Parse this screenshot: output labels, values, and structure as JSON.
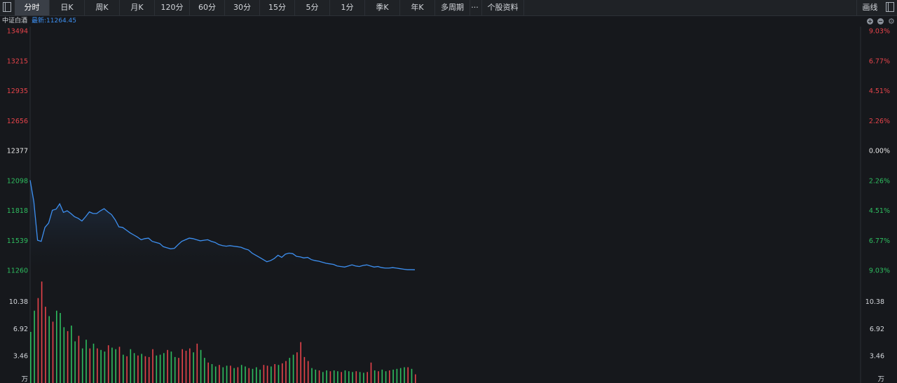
{
  "toolbar": {
    "tabs": [
      {
        "label": "分时",
        "active": true
      },
      {
        "label": "日K"
      },
      {
        "label": "周K"
      },
      {
        "label": "月K"
      },
      {
        "label": "120分"
      },
      {
        "label": "60分"
      },
      {
        "label": "30分"
      },
      {
        "label": "15分"
      },
      {
        "label": "5分"
      },
      {
        "label": "1分"
      },
      {
        "label": "季K"
      },
      {
        "label": "年K"
      },
      {
        "label": "多周期"
      }
    ],
    "more_label": "···",
    "stock_info_label": "个股资料",
    "draw_label": "画线"
  },
  "header": {
    "name": "中证白酒",
    "latest_label": "最新:11264.45"
  },
  "colors": {
    "up": "#e6434a",
    "down": "#2ebd5f",
    "neutral": "#e8e8e8",
    "line": "#3d8ff0",
    "background": "#16181c"
  },
  "chart_data": {
    "type": "line",
    "price_axis_labels": [
      "13494",
      "13215",
      "12935",
      "12656",
      "12377",
      "12098",
      "11818",
      "11539",
      "11260"
    ],
    "percent_axis_labels": [
      "9.03%",
      "6.77%",
      "4.51%",
      "2.26%",
      "0.00%",
      "2.26%",
      "4.51%",
      "6.77%",
      "9.03%"
    ],
    "ylim": [
      11260,
      13494
    ],
    "prev_close": 12377,
    "price": [
      12100,
      11900,
      11540,
      11530,
      11660,
      11700,
      11820,
      11830,
      11880,
      11800,
      11815,
      11790,
      11760,
      11745,
      11720,
      11760,
      11805,
      11790,
      11790,
      11815,
      11835,
      11805,
      11780,
      11730,
      11665,
      11660,
      11635,
      11610,
      11590,
      11570,
      11545,
      11555,
      11560,
      11530,
      11520,
      11510,
      11480,
      11470,
      11460,
      11465,
      11500,
      11530,
      11545,
      11560,
      11555,
      11545,
      11535,
      11540,
      11545,
      11530,
      11520,
      11500,
      11490,
      11485,
      11490,
      11485,
      11480,
      11475,
      11460,
      11450,
      11420,
      11400,
      11380,
      11360,
      11340,
      11350,
      11370,
      11400,
      11380,
      11410,
      11420,
      11415,
      11390,
      11385,
      11375,
      11380,
      11360,
      11350,
      11345,
      11335,
      11325,
      11320,
      11315,
      11300,
      11295,
      11290,
      11300,
      11310,
      11300,
      11295,
      11305,
      11310,
      11300,
      11290,
      11295,
      11285,
      11280,
      11280,
      11285,
      11280,
      11275,
      11270,
      11265,
      11265,
      11264.45
    ],
    "volume_axis_labels": [
      "10.38",
      "6.92",
      "3.46",
      "万"
    ],
    "volume_max": 13.8,
    "volume": [
      6.5,
      9.2,
      10.8,
      12.9,
      9.7,
      8.5,
      7.8,
      9.2,
      8.9,
      7.1,
      6.6,
      7.3,
      5.3,
      6.0,
      4.4,
      5.5,
      4.4,
      5.0,
      4.4,
      4.2,
      4.0,
      4.8,
      4.5,
      4.3,
      4.6,
      3.6,
      3.4,
      4.3,
      3.8,
      3.5,
      3.7,
      3.4,
      3.3,
      4.3,
      3.5,
      3.6,
      3.8,
      4.2,
      4.0,
      3.3,
      3.2,
      4.3,
      4.1,
      4.4,
      3.9,
      5.0,
      4.2,
      3.2,
      2.6,
      2.4,
      2.1,
      2.3,
      2.0,
      2.2,
      2.2,
      1.9,
      2.0,
      2.3,
      2.1,
      1.9,
      1.8,
      2.0,
      1.7,
      2.3,
      2.2,
      2.1,
      2.4,
      2.3,
      2.5,
      2.8,
      3.2,
      3.6,
      3.9,
      5.2,
      3.3,
      2.8,
      1.9,
      1.7,
      1.6,
      1.4,
      1.6,
      1.5,
      1.6,
      1.5,
      1.4,
      1.6,
      1.5,
      1.4,
      1.5,
      1.4,
      1.3,
      1.4,
      2.6,
      1.6,
      1.5,
      1.7,
      1.5,
      1.6,
      1.7,
      1.8,
      1.9,
      2.0,
      2.0,
      1.8,
      1.1
    ],
    "volume_up": [
      false,
      false,
      true,
      true,
      true,
      false,
      true,
      false,
      false,
      false,
      true,
      false,
      false,
      true,
      false,
      false,
      true,
      false,
      true,
      false,
      false,
      true,
      false,
      false,
      true,
      false,
      true,
      false,
      false,
      true,
      false,
      true,
      true,
      true,
      false,
      false,
      false,
      true,
      false,
      false,
      true,
      true,
      true,
      true,
      false,
      true,
      false,
      false,
      true,
      false,
      false,
      true,
      false,
      false,
      true,
      false,
      true,
      false,
      false,
      true,
      false,
      false,
      false,
      true,
      true,
      false,
      true,
      false,
      true,
      true,
      false,
      false,
      true,
      true,
      true,
      true,
      false,
      false,
      true,
      false,
      false,
      true,
      false,
      false,
      true,
      false,
      false,
      false,
      true,
      false,
      false,
      true,
      true,
      false,
      true,
      false,
      false,
      true,
      false,
      false,
      false,
      false,
      true,
      false,
      true
    ]
  }
}
